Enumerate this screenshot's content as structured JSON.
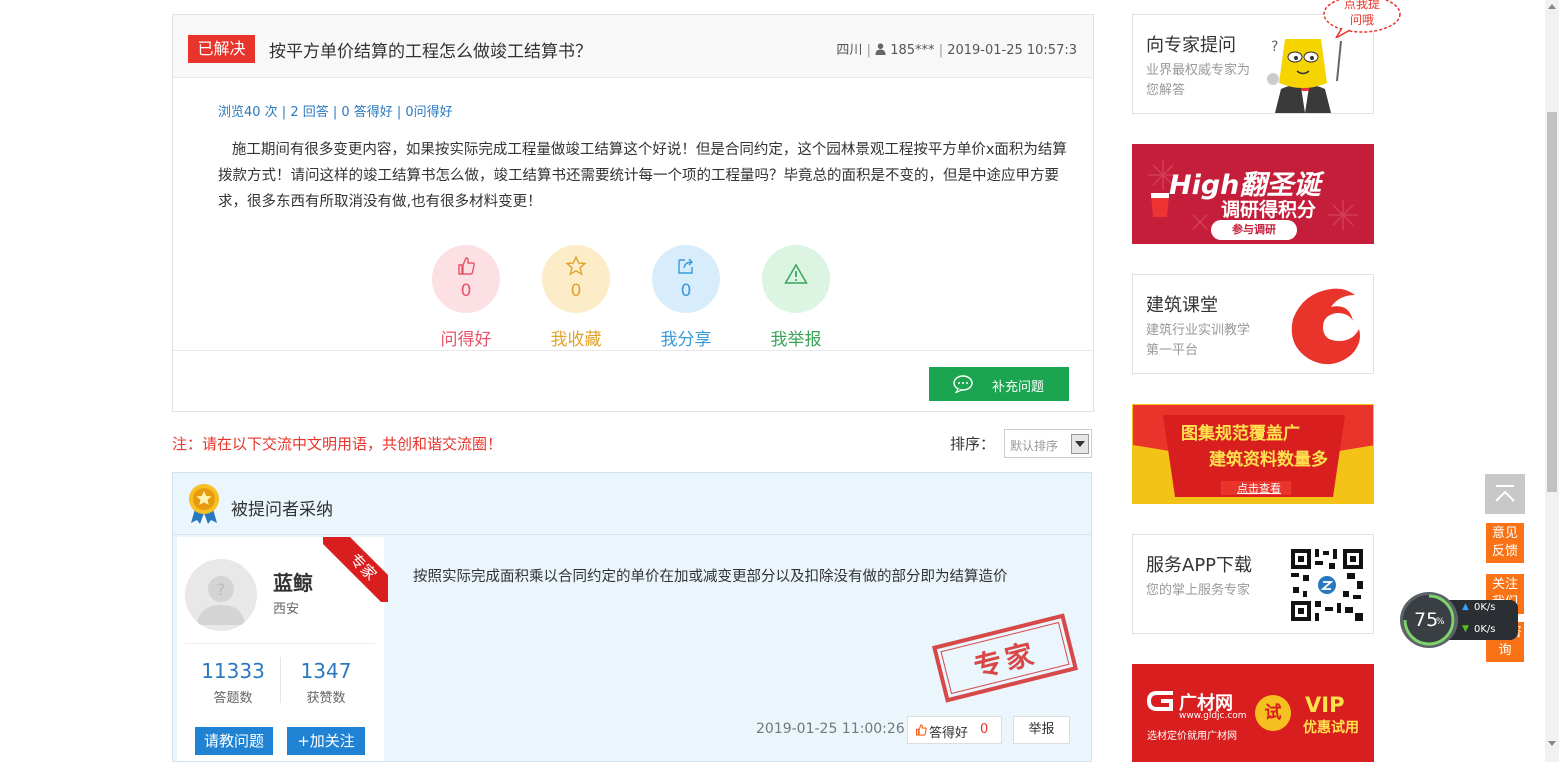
{
  "question": {
    "status_badge": "已解决",
    "title": "按平方单价结算的工程怎么做竣工结算书？",
    "meta": {
      "location": "四川",
      "user": "185***",
      "datetime": "2019-01-25 10:57:3"
    },
    "stats": "浏览40 次 | 2 回答 | 0 答得好 | 0问得好",
    "body": "施工期间有很多变更内容，如果按实际完成工程量做竣工结算这个好说！但是合同约定，这个园林景观工程按平方单价x面积为结算拨款方式！请问这样的竣工结算书怎么做，竣工结算书还需要统计每一个项的工程量吗？毕竟总的面积是不变的，但是中途应甲方要求，很多东西有所取消没有做,也有很多材料变更！",
    "actions": [
      {
        "label": "问得好",
        "count": "0",
        "icon": "thumbs-up-icon",
        "color": "#e8546a",
        "bg": "#fde0e4"
      },
      {
        "label": "我收藏",
        "count": "0",
        "icon": "star-icon",
        "color": "#e0a42a",
        "bg": "#fdecc8"
      },
      {
        "label": "我分享",
        "count": "0",
        "icon": "share-icon",
        "color": "#3a9ad9",
        "bg": "#d8edfb"
      },
      {
        "label": "我举报",
        "count": "",
        "icon": "warning-icon",
        "color": "#3aa55a",
        "bg": "#dcf4e2"
      }
    ],
    "supplement_button": "补充问题"
  },
  "notice": "注：请在以下交流中文明用语，共创和谐交流圈！",
  "sort": {
    "label": "排序：",
    "selected": "默认排序"
  },
  "answer": {
    "section_title": "被提问者采纳",
    "user": {
      "name": "蓝鲸",
      "location": "西安",
      "answers_count": "11333",
      "answers_label": "答题数",
      "likes_count": "1347",
      "likes_label": "获赞数",
      "ask_button": "请教问题",
      "follow_button": "+加关注",
      "ribbon": "专家"
    },
    "text": "按照实际完成面积乘以合同约定的单价在加或减变更部分以及扣除没有做的部分即为结算造价",
    "stamp": "专家",
    "datetime": "2019-01-25 11:00:26",
    "good_label": "答得好",
    "good_count": "0",
    "report_label": "举报"
  },
  "sidebar": {
    "expert": {
      "title": "向专家提问",
      "sub": "业界最权威专家为您解答",
      "bubble": "点我提问哦"
    },
    "christmas": {
      "line1": "High翻圣诞",
      "line2": "调研得积分",
      "button": "参与调研"
    },
    "academy": {
      "title": "建筑课堂",
      "sub": "建筑行业实训教学第一平台"
    },
    "atlas": {
      "line1": "图集规范覆盖广",
      "line2": "建筑资料数量多",
      "button": "点击查看"
    },
    "app": {
      "title": "服务APP下载",
      "sub": "您的掌上服务专家"
    },
    "gcw": {
      "brand": "广材网",
      "url": "www.gldjc.com",
      "slogan": "选材定价就用广材网",
      "trial": "试",
      "vip": "VIP",
      "vip_sub": "优惠试用"
    }
  },
  "float_buttons": {
    "feedback": "意见反馈",
    "follow": "关注我们",
    "qq": "QQ咨询"
  },
  "net_widget": {
    "percent": "75",
    "unit": "%",
    "up": "0K/s",
    "down": "0K/s"
  }
}
